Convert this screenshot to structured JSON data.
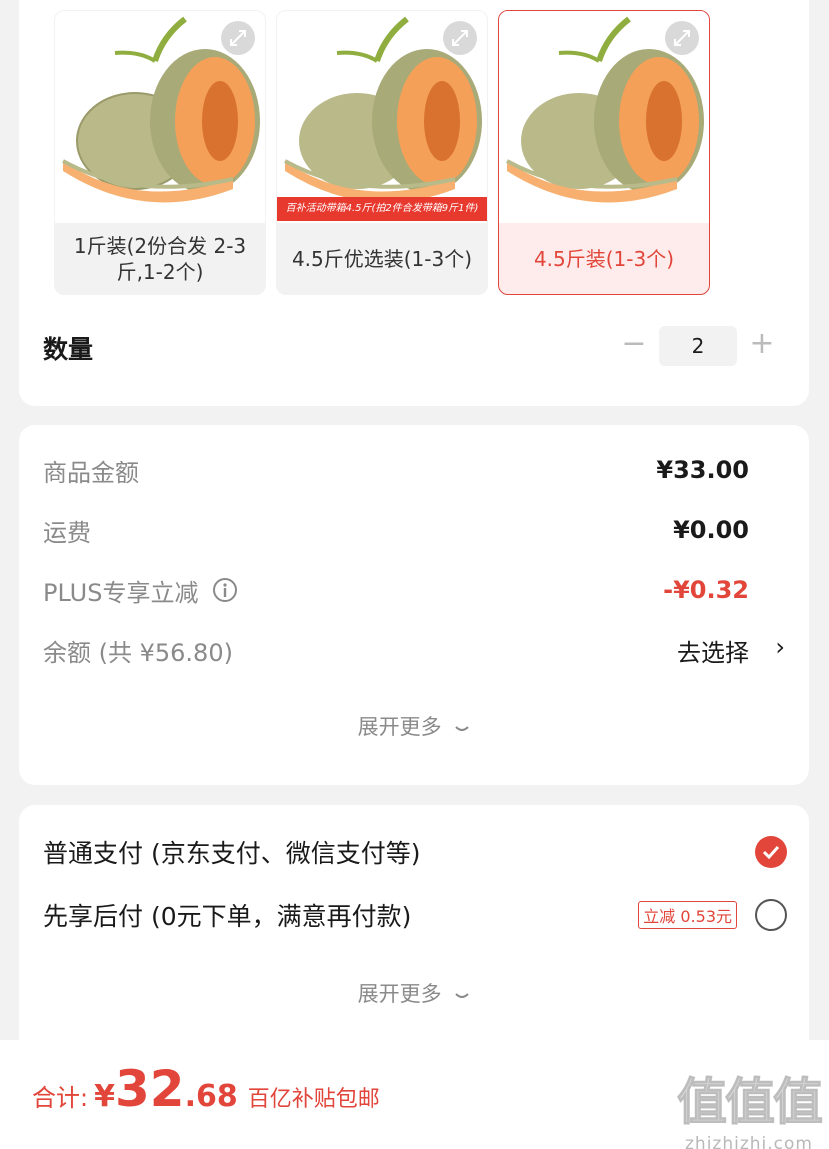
{
  "specs": [
    {
      "label": "1斤装(2份合发 2-3斤,1-2个)"
    },
    {
      "label": "4.5斤优选装(1-3个)",
      "promo": "百补活动带箱4.5斤(拍2件合发带箱9斤1件)"
    },
    {
      "label": "4.5斤装(1-3个)",
      "selected": true
    }
  ],
  "quantity": {
    "label": "数量",
    "minus": "−",
    "value": "2",
    "plus": "+"
  },
  "price": {
    "rows": [
      {
        "label": "商品金额",
        "value": "¥33.00"
      },
      {
        "label": "运费",
        "value": "¥0.00"
      },
      {
        "label": "PLUS专享立减",
        "value": "-¥0.32"
      },
      {
        "label": "余额 (共 ¥56.80)",
        "value": "去选择"
      }
    ],
    "expand": "展开更多",
    "chevron": "›"
  },
  "payment": {
    "options": [
      {
        "label": "普通支付 (京东支付、微信支付等)",
        "selected": true
      },
      {
        "label": "先享后付 (0元下单，满意再付款)",
        "badge": "立减 0.53元",
        "selected": false
      }
    ],
    "expand": "展开更多"
  },
  "total": {
    "label": "合计:",
    "currency": "¥",
    "integer": "32",
    "decimal": ".68",
    "note": "百亿补贴包邮"
  },
  "watermark": {
    "glyphs": "值值值",
    "url": "zhizhizhi.com"
  },
  "colors": {
    "accent": "#e2453a",
    "background": "#f2f2f2"
  }
}
